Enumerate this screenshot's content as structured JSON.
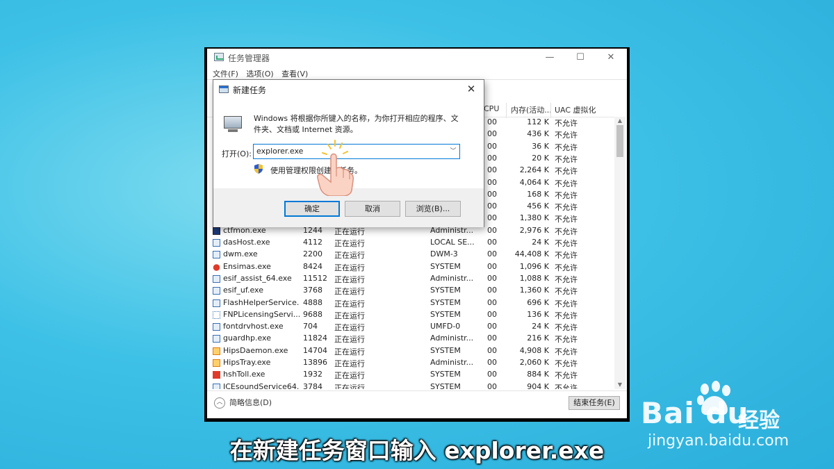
{
  "task_manager": {
    "title": "任务管理器",
    "menu": [
      "文件(F)",
      "选项(O)",
      "查看(V)"
    ],
    "window_buttons": {
      "minimize": "—",
      "maximize": "☐",
      "close": "✕"
    },
    "headers": {
      "cpu": "CPU",
      "memory": "内存(活动...",
      "uac": "UAC 虚拟化"
    },
    "hidden_rows": [
      {
        "cpu": "00",
        "memory": "112 K",
        "uac": "不允许"
      },
      {
        "cpu": "00",
        "memory": "436 K",
        "uac": "不允许"
      },
      {
        "cpu": "00",
        "memory": "36 K",
        "uac": "不允许"
      },
      {
        "cpu": "00",
        "memory": "20 K",
        "uac": "不允许"
      },
      {
        "cpu": "00",
        "memory": "2,264 K",
        "uac": "不允许"
      },
      {
        "cpu": "00",
        "memory": "4,064 K",
        "uac": "不允许"
      },
      {
        "cpu": "00",
        "memory": "168 K",
        "uac": "不允许"
      },
      {
        "cpu": "00",
        "memory": "456 K",
        "uac": "不允许"
      },
      {
        "cpu": "00",
        "memory": "1,380 K",
        "uac": "不允许"
      }
    ],
    "rows": [
      {
        "name": "ctfmon.exe",
        "pid": "1244",
        "status": "正在运行",
        "user": "Administr...",
        "cpu": "00",
        "memory": "2,976 K",
        "uac": "不允许",
        "icon": "dark"
      },
      {
        "name": "dasHost.exe",
        "pid": "4112",
        "status": "正在运行",
        "user": "LOCAL SE...",
        "cpu": "00",
        "memory": "24 K",
        "uac": "不允许",
        "icon": "app"
      },
      {
        "name": "dwm.exe",
        "pid": "2200",
        "status": "正在运行",
        "user": "DWM-3",
        "cpu": "00",
        "memory": "44,408 K",
        "uac": "不允许",
        "icon": "app"
      },
      {
        "name": "Ensimas.exe",
        "pid": "8424",
        "status": "正在运行",
        "user": "SYSTEM",
        "cpu": "00",
        "memory": "1,096 K",
        "uac": "不允许",
        "icon": "red"
      },
      {
        "name": "esif_assist_64.exe",
        "pid": "11512",
        "status": "正在运行",
        "user": "Administr...",
        "cpu": "00",
        "memory": "1,088 K",
        "uac": "不允许",
        "icon": "app"
      },
      {
        "name": "esif_uf.exe",
        "pid": "3768",
        "status": "正在运行",
        "user": "SYSTEM",
        "cpu": "00",
        "memory": "1,360 K",
        "uac": "不允许",
        "icon": "app"
      },
      {
        "name": "FlashHelperService...",
        "pid": "4888",
        "status": "正在运行",
        "user": "SYSTEM",
        "cpu": "00",
        "memory": "696 K",
        "uac": "不允许",
        "icon": "app"
      },
      {
        "name": "FNPLicensingServi...",
        "pid": "9688",
        "status": "正在运行",
        "user": "SYSTEM",
        "cpu": "00",
        "memory": "136 K",
        "uac": "不允许",
        "icon": "grid"
      },
      {
        "name": "fontdrvhost.exe",
        "pid": "704",
        "status": "正在运行",
        "user": "UMFD-0",
        "cpu": "00",
        "memory": "24 K",
        "uac": "不允许",
        "icon": "app"
      },
      {
        "name": "guardhp.exe",
        "pid": "11824",
        "status": "正在运行",
        "user": "Administr...",
        "cpu": "00",
        "memory": "216 K",
        "uac": "不允许",
        "icon": "app"
      },
      {
        "name": "HipsDaemon.exe",
        "pid": "14704",
        "status": "正在运行",
        "user": "SYSTEM",
        "cpu": "00",
        "memory": "4,908 K",
        "uac": "不允许",
        "icon": "orange"
      },
      {
        "name": "HipsTray.exe",
        "pid": "13896",
        "status": "正在运行",
        "user": "Administr...",
        "cpu": "00",
        "memory": "2,060 K",
        "uac": "不允许",
        "icon": "orange"
      },
      {
        "name": "hshToll.exe",
        "pid": "1932",
        "status": "正在运行",
        "user": "SYSTEM",
        "cpu": "00",
        "memory": "884 K",
        "uac": "不允许",
        "icon": "flash"
      },
      {
        "name": "ICEsoundService64...",
        "pid": "3784",
        "status": "正在运行",
        "user": "SYSTEM",
        "cpu": "00",
        "memory": "904 K",
        "uac": "不允许",
        "icon": "app"
      }
    ],
    "fewer_details": "简略信息(D)",
    "end_task": "结束任务(E)"
  },
  "run_dialog": {
    "title": "新建任务",
    "close": "✕",
    "description": "Windows 将根据你所键入的名称，为你打开相应的程序、文件夹、文档或 Internet 资源。",
    "open_label": "打开(O):",
    "input_value": "explorer.exe",
    "admin_note": "使用管理权限创建此任务。",
    "ok": "确定",
    "cancel": "取消",
    "browse": "浏览(B)..."
  },
  "caption": "在新建任务窗口输入 explorer.exe",
  "watermark": {
    "logo": "Bai du",
    "brand": "经验",
    "url": "jingyan.baidu.com"
  },
  "colors": {
    "background": "#3ec1e6",
    "focus": "#0078d7",
    "caption": "#ffffff"
  }
}
